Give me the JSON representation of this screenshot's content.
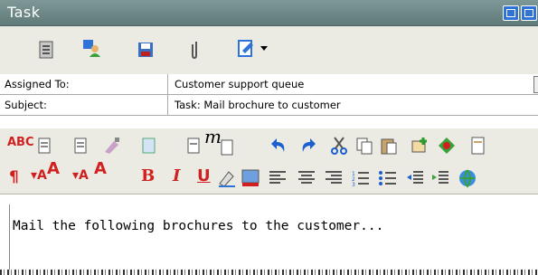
{
  "window": {
    "title": "Task"
  },
  "fields": [
    {
      "label": "Assigned To:",
      "value": "Customer support queue"
    },
    {
      "label": "Subject:",
      "value": "Task: Mail brochure to customer"
    }
  ],
  "body": {
    "text": "Mail the following brochures to the customer..."
  },
  "format": {
    "italic_m": "m",
    "spell": "ABC",
    "bold": "B",
    "italic": "I",
    "underline": "U",
    "font_a": "A"
  },
  "colors": {
    "titlebar": "#6f8a88",
    "toolbar": "#ecebe3",
    "accent_blue": "#2f73d7",
    "icon_red": "#d02020"
  }
}
